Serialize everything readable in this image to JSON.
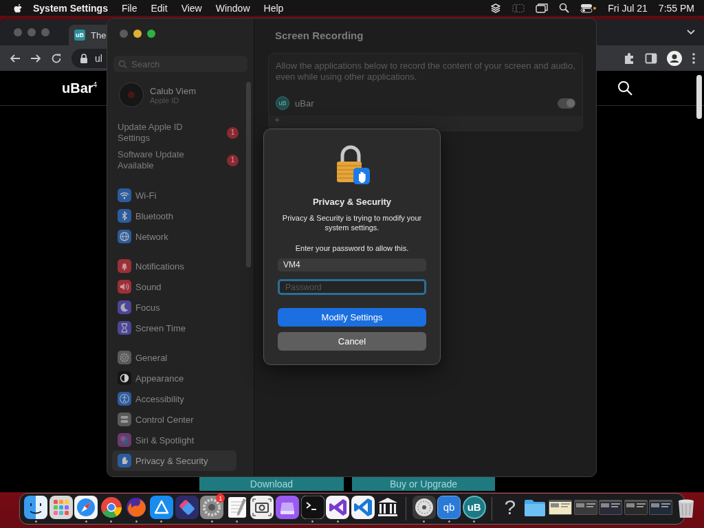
{
  "menu_bar": {
    "app_name": "System Settings",
    "menus": [
      "File",
      "Edit",
      "View",
      "Window",
      "Help"
    ],
    "date": "Fri Jul 21",
    "time": "7:55 PM"
  },
  "browser": {
    "tab": {
      "icon_text": "uB",
      "title": "The"
    },
    "address": "ul",
    "site_logo": "uBar$^{4}$",
    "buttons": [
      "Download",
      "Buy or Upgrade"
    ]
  },
  "settings": {
    "search": {
      "placeholder": "Search"
    },
    "account": {
      "name": "Calub Viem",
      "subtitle": "Apple ID"
    },
    "notices": [
      {
        "label": "Update Apple ID Settings",
        "badge": "1"
      },
      {
        "label": "Software Update Available",
        "badge": "1"
      }
    ],
    "sidebar_groups": [
      [
        {
          "label": "Wi-Fi",
          "color": "#2b5c9e",
          "selected": false
        },
        {
          "label": "Bluetooth",
          "color": "#2b5c9e",
          "selected": false
        },
        {
          "label": "Network",
          "color": "#2b5c9e",
          "selected": false
        }
      ],
      [
        {
          "label": "Notifications",
          "color": "#9a3038",
          "selected": false
        },
        {
          "label": "Sound",
          "color": "#9a3038",
          "selected": false
        },
        {
          "label": "Focus",
          "color": "#4d4596",
          "selected": false
        },
        {
          "label": "Screen Time",
          "color": "#4d4596",
          "selected": false
        }
      ],
      [
        {
          "label": "General",
          "color": "#5a5a5a",
          "selected": false
        },
        {
          "label": "Appearance",
          "color": "#161616",
          "selected": false
        },
        {
          "label": "Accessibility",
          "color": "#2b5c9e",
          "selected": false
        },
        {
          "label": "Control Center",
          "color": "#5a5a5a",
          "selected": false
        },
        {
          "label": "Siri & Spotlight",
          "color": "#6a3a70",
          "selected": false
        },
        {
          "label": "Privacy & Security",
          "color": "#2b5c9e",
          "selected": true
        }
      ]
    ],
    "page": {
      "title": "Screen Recording",
      "description": "Allow the applications below to record the content of your screen and audio, even while using other applications.",
      "apps": [
        {
          "icon_text": "uB",
          "name": "uBar",
          "on": true
        }
      ],
      "add_label": "+"
    }
  },
  "dialog": {
    "title": "Privacy & Security",
    "message": "Privacy & Security is trying to modify your system settings.",
    "prompt": "Enter your password to allow this.",
    "username": "VM4",
    "password": {
      "placeholder": "Password",
      "focused": true
    },
    "buttons": [
      {
        "label": "Modify Settings",
        "default": true
      },
      {
        "label": "Cancel",
        "default": false
      }
    ]
  },
  "dock": {
    "items": [
      {
        "kind": "app",
        "running": true
      },
      {
        "kind": "app",
        "running": false
      },
      {
        "kind": "app",
        "running": true
      },
      {
        "kind": "app",
        "running": true
      },
      {
        "kind": "app",
        "running": true
      },
      {
        "kind": "app",
        "running": true
      },
      {
        "kind": "app",
        "running": false
      },
      {
        "kind": "app",
        "running": true,
        "badge": "1"
      },
      {
        "kind": "app",
        "running": true
      },
      {
        "kind": "app",
        "running": false
      },
      {
        "kind": "app",
        "running": false
      },
      {
        "kind": "app",
        "running": true
      },
      {
        "kind": "app",
        "running": true
      },
      {
        "kind": "app",
        "running": false
      },
      {
        "kind": "app",
        "running": false
      },
      {
        "kind": "separator"
      },
      {
        "kind": "app",
        "running": true
      },
      {
        "kind": "app",
        "running": true,
        "icon_text": "qb"
      },
      {
        "kind": "app",
        "running": true,
        "icon_text": "uB"
      },
      {
        "kind": "separator"
      },
      {
        "kind": "app",
        "running": false,
        "icon_text": "?"
      },
      {
        "kind": "app",
        "running": false
      },
      {
        "kind": "window"
      },
      {
        "kind": "window"
      },
      {
        "kind": "window"
      },
      {
        "kind": "window"
      },
      {
        "kind": "window"
      },
      {
        "kind": "app",
        "running": false
      }
    ]
  }
}
